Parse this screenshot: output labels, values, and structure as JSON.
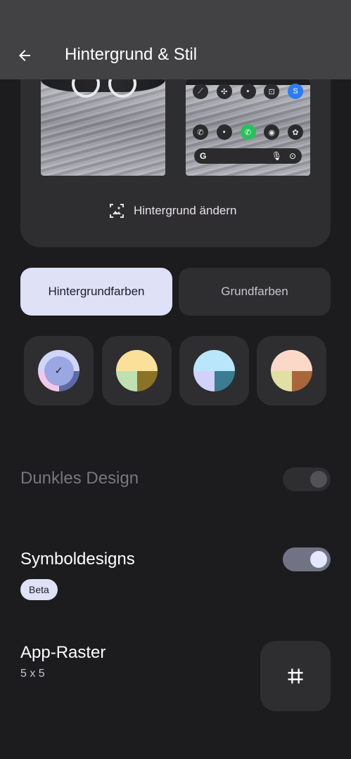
{
  "header": {
    "title": "Hintergrund & Stil"
  },
  "preview": {
    "change_wallpaper_label": "Hintergrund ändern"
  },
  "tabs": {
    "active": "Hintergrundfarben",
    "inactive": "Grundfarben"
  },
  "swatches": [
    {
      "top": "#cfd6f8",
      "bl": "#f2c8ea",
      "br": "#5d6aa6",
      "selected": true
    },
    {
      "top": "#fbe09a",
      "bl": "#bfe0b0",
      "br": "#8a7226",
      "selected": false
    },
    {
      "top": "#b9e6fb",
      "bl": "#d2d1fa",
      "br": "#3a7d93",
      "selected": false
    },
    {
      "top": "#fbd8c8",
      "bl": "#dfe0a1",
      "br": "#a8663a",
      "selected": false
    }
  ],
  "settings": {
    "dark_theme": {
      "label": "Dunkles Design",
      "enabled": false
    },
    "icon_designs": {
      "label": "Symboldesigns",
      "badge": "Beta",
      "enabled": true
    },
    "app_grid": {
      "label": "App-Raster",
      "value": "5 x 5"
    }
  },
  "colors": {
    "background": "#1c1c1f",
    "surface": "#2e2e31",
    "accent": "#dfe1f6",
    "header": "#424244"
  }
}
